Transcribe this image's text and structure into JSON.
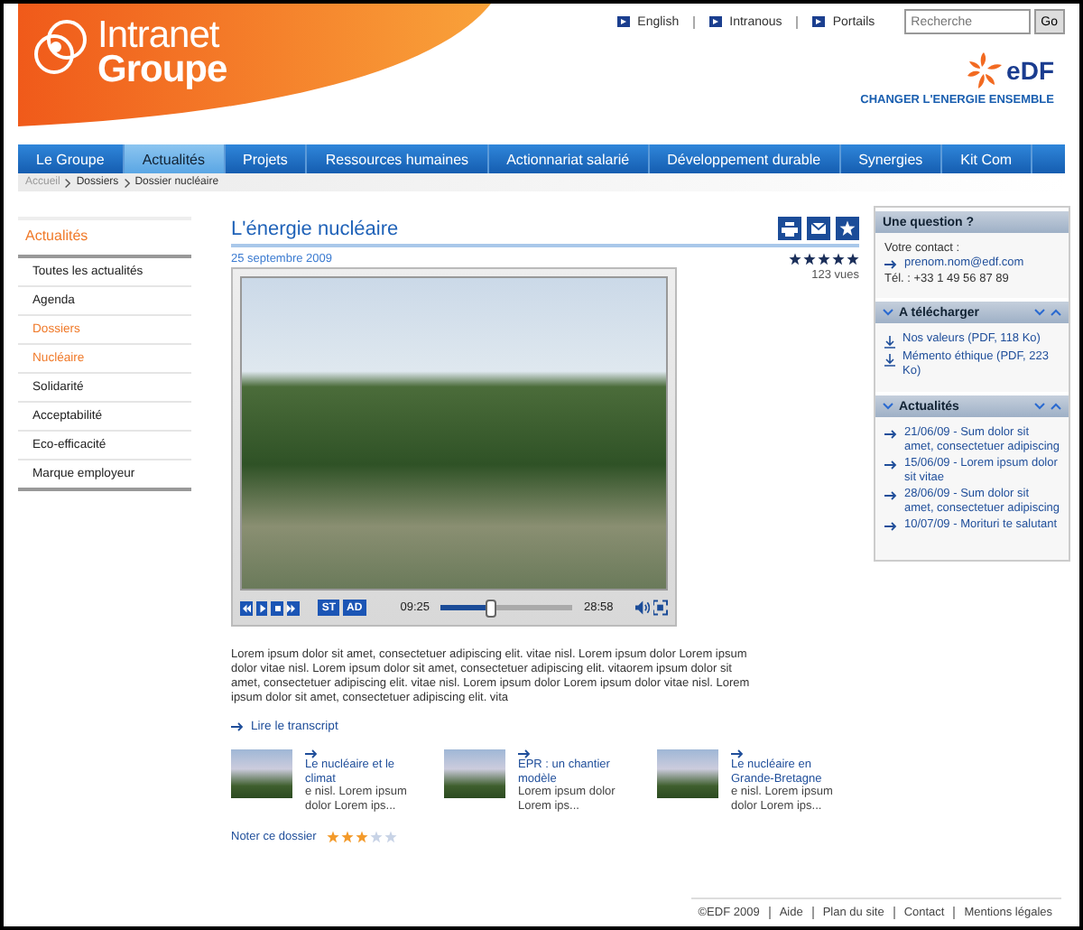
{
  "header": {
    "logo_line_1": "Intranet",
    "logo_line_2": "Groupe",
    "top_links": [
      "English",
      "Intranous",
      "Portails"
    ],
    "search": {
      "placeholder": "Recherche",
      "button": "Go"
    },
    "brand": "eDF",
    "tagline": "CHANGER L'ENERGIE ENSEMBLE"
  },
  "nav": [
    {
      "label": "Le Groupe",
      "selected": false
    },
    {
      "label": "Actualités",
      "selected": true
    },
    {
      "label": "Projets",
      "selected": false
    },
    {
      "label": "Ressources humaines",
      "selected": false
    },
    {
      "label": "Actionnariat salarié",
      "selected": false
    },
    {
      "label": "Développement durable",
      "selected": false
    },
    {
      "label": "Synergies",
      "selected": false
    },
    {
      "label": "Kit Com",
      "selected": false
    }
  ],
  "breadcrumb": [
    "Accueil",
    "Dossiers",
    "Dossier nucléaire"
  ],
  "sidebar": {
    "title": "Actualités",
    "items": [
      {
        "label": "Toutes les actualités",
        "selected": false
      },
      {
        "label": "Agenda",
        "selected": false
      },
      {
        "label": "Dossiers",
        "selected": true
      },
      {
        "label": "Nucléaire",
        "selected": true
      },
      {
        "label": "Solidarité",
        "selected": false
      },
      {
        "label": "Acceptabilité",
        "selected": false
      },
      {
        "label": "Eco-efficacité",
        "selected": false
      },
      {
        "label": "Marque employeur",
        "selected": false
      }
    ]
  },
  "article": {
    "title": "L'énergie nucléaire",
    "date": "25 septembre 2009",
    "stars": 5,
    "views": "123 vues",
    "player": {
      "subtitles": "ST",
      "audio_description": "AD",
      "elapsed": "09:25",
      "level": 0.38,
      "duration": "28:58"
    },
    "body": "Lorem ipsum dolor sit amet, consectetuer adipiscing elit. vitae nisl. Lorem ipsum dolor Lorem ipsum dolor vitae nisl. Lorem ipsum dolor sit amet, consectetuer adipiscing elit. vitaorem ipsum dolor sit amet, consectetuer adipiscing elit. vitae nisl. Lorem ipsum dolor Lorem ipsum dolor vitae nisl. Lorem ipsum dolor sit amet, consectetuer adipiscing elit. vita",
    "transcript_link": "Lire le transcript",
    "related": [
      {
        "title": "Le nucléaire et le climat",
        "excerpt": "e nisl. Lorem ipsum dolor Lorem ips..."
      },
      {
        "title": "EPR : un chantier modèle",
        "excerpt": "Lorem ipsum dolor Lorem ips..."
      },
      {
        "title": "Le nucléaire en Grande-Bretagne",
        "excerpt": "e nisl. Lorem ipsum dolor Lorem ips..."
      }
    ],
    "rate_label": "Noter ce dossier",
    "rating": {
      "stars": 3
    }
  },
  "right_panel": {
    "question": {
      "title": "Une question ?",
      "label": "Votre contact :",
      "email": "prenom.nom@edf.com",
      "phone": "Tél. : +33 1 49 56 87 89"
    },
    "downloads": {
      "title": "A télécharger",
      "items": [
        "Nos valeurs (PDF, 118 Ko)",
        "Mémento éthique (PDF, 223 Ko)"
      ]
    },
    "news": {
      "title": "Actualités",
      "items": [
        "21/06/09 - Sum dolor sit amet, consectetuer adipiscing",
        "15/06/09 - Lorem ipsum dolor sit vitae",
        "28/06/09 - Sum dolor sit amet, consectetuer adipiscing",
        "10/07/09 - Morituri te salutant"
      ]
    }
  },
  "footer": [
    "©EDF 2009",
    "Aide",
    "Plan du site",
    "Contact",
    "Mentions légales"
  ]
}
